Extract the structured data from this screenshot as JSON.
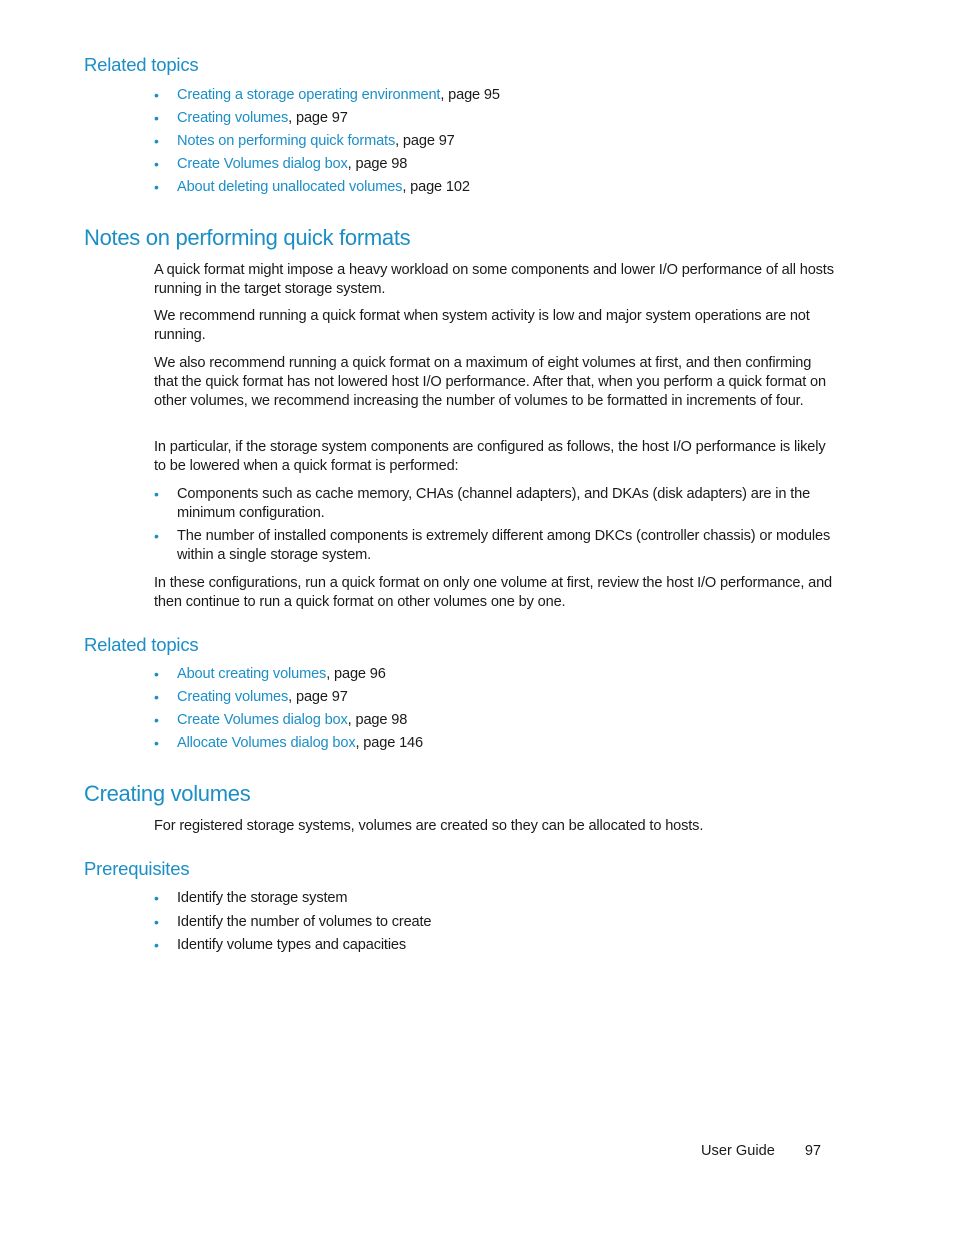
{
  "section1": {
    "heading": "Related topics",
    "links": [
      {
        "text": "Creating a storage operating environment",
        "suffix": ", page 95"
      },
      {
        "text": "Creating volumes",
        "suffix": ", page 97"
      },
      {
        "text": "Notes on performing quick formats",
        "suffix": ", page 97"
      },
      {
        "text": "Create Volumes dialog box",
        "suffix": ", page 98"
      },
      {
        "text": "About deleting unallocated volumes",
        "suffix": ", page 102"
      }
    ]
  },
  "notes": {
    "heading": "Notes on performing quick formats",
    "paragraphs": [
      "A quick format might impose a heavy workload on some components and lower I/O performance of all hosts running in the target storage system.",
      "We recommend running a quick format when system activity is low and major system operations are not running.",
      "We also recommend running a quick format on a maximum of eight volumes at first, and then confirming that the quick format has not lowered host I/O performance. After that, when you perform a quick format on other volumes, we recommend increasing the number of volumes to be formatted in increments of four.",
      "In particular, if the storage system components are configured as follows, the host I/O performance is likely to be lowered when a quick format is performed:"
    ],
    "bullets": [
      "Components such as cache memory, CHAs (channel adapters), and DKAs (disk adapters) are in the minimum configuration.",
      "The number of installed components is extremely different among DKCs (controller chassis) or modules within a single storage system."
    ],
    "closing": "In these configurations, run a quick format on only one volume at first, review the host I/O performance, and then continue to run a quick format on other volumes one by one."
  },
  "section2": {
    "heading": "Related topics",
    "links": [
      {
        "text": "About creating volumes",
        "suffix": ", page 96"
      },
      {
        "text": "Creating volumes",
        "suffix": ", page 97"
      },
      {
        "text": "Create Volumes dialog box",
        "suffix": ", page 98"
      },
      {
        "text": "Allocate Volumes dialog box",
        "suffix": ", page 146"
      }
    ]
  },
  "creating": {
    "heading": "Creating volumes",
    "intro": "For registered storage systems, volumes are created so they can be allocated to hosts.",
    "prereq_heading": "Prerequisites",
    "prereqs": [
      "Identify the storage system",
      "Identify the number of volumes to create",
      "Identify volume types and capacities"
    ]
  },
  "footer": {
    "guide": "User Guide",
    "page": "97"
  },
  "bullet_char": "•",
  "colors": {
    "accent": "#1b8ec6",
    "text": "#1a1a1a"
  }
}
